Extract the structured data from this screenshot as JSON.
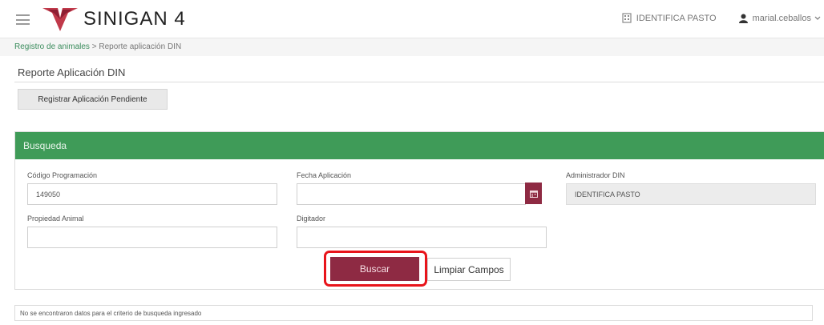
{
  "header": {
    "brand": "SINIGAN 4",
    "org_label": "IDENTIFICA PASTO",
    "user_label": "marial.ceballos",
    "icons": {
      "menu": "hamburger-menu-icon",
      "logo": "sinigan-logo",
      "org": "office-icon",
      "user": "user-icon",
      "caret": "caret-down-icon"
    }
  },
  "breadcrumb": {
    "link": "Registro de animales",
    "separator": " > ",
    "current": "Reporte aplicación DIN"
  },
  "page": {
    "title": "Reporte Aplicación DIN",
    "register_button": "Registrar Aplicación Pendiente"
  },
  "search_panel": {
    "title": "Busqueda",
    "fields": {
      "codigo": {
        "label": "Código Programación",
        "value": "149050"
      },
      "fecha": {
        "label": "Fecha Aplicación",
        "value": ""
      },
      "administrador": {
        "label": "Administrador DIN",
        "value": "IDENTIFICA PASTO"
      },
      "propiedad": {
        "label": "Propiedad Animal",
        "value": ""
      },
      "digitador": {
        "label": "Digitador",
        "value": ""
      }
    },
    "buttons": {
      "search": "Buscar",
      "clear": "Limpiar Campos"
    }
  },
  "status_message": "No se encontraron datos para el criterio de busqueda ingresado",
  "colors": {
    "accent_green": "#3f9b58",
    "button_maroon": "#8e2a43",
    "highlight_red": "#e8141b"
  }
}
